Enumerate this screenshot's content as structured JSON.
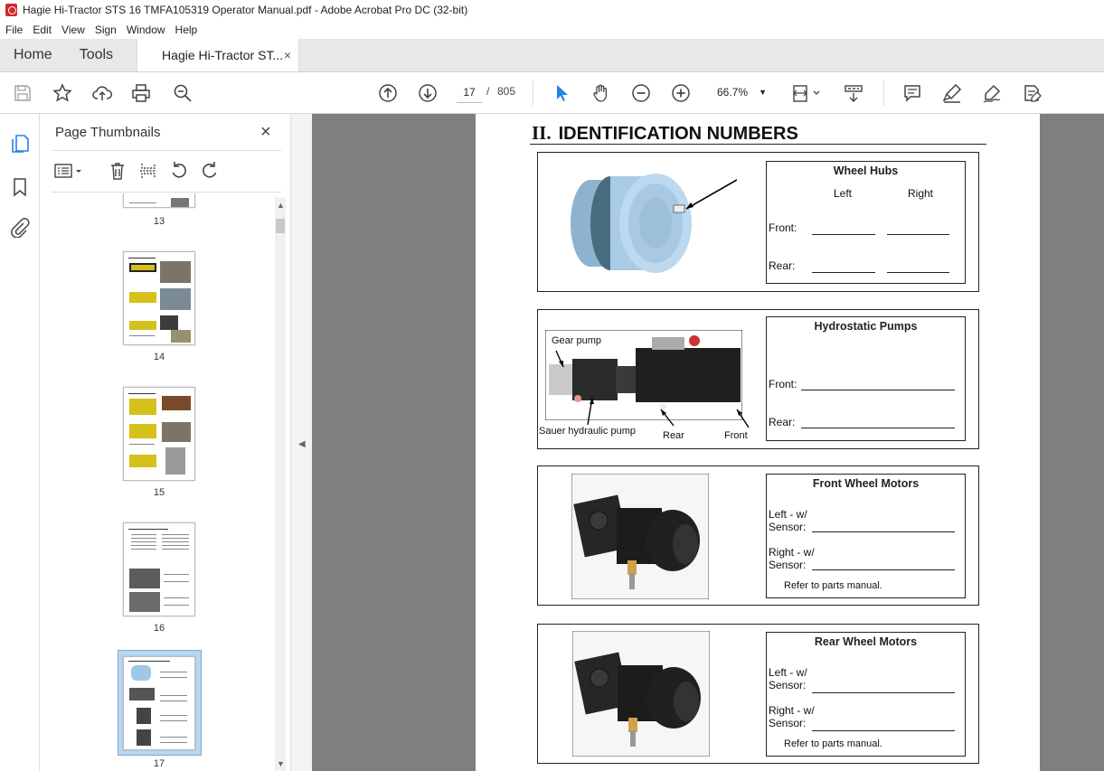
{
  "window": {
    "title": "Hagie Hi-Tractor STS 16 TMFA105319 Operator Manual.pdf - Adobe Acrobat Pro DC (32-bit)"
  },
  "menu": [
    "File",
    "Edit",
    "View",
    "Sign",
    "Window",
    "Help"
  ],
  "tabs": {
    "home": "Home",
    "tools": "Tools",
    "doc": "Hagie Hi-Tractor ST...",
    "close": "×"
  },
  "toolbar": {
    "page_current": "17",
    "page_sep": "/",
    "page_total": "805",
    "zoom": "66.7%"
  },
  "thumbnails": {
    "title": "Page Thumbnails",
    "close": "×",
    "pages": [
      "13",
      "14",
      "15",
      "16",
      "17"
    ],
    "selected": "17"
  },
  "document": {
    "roman": "II.",
    "heading": "IDENTIFICATION NUMBERS",
    "wheel_hubs": {
      "title": "Wheel Hubs",
      "left": "Left",
      "right": "Right",
      "front": "Front:",
      "rear": "Rear:"
    },
    "hydrostatic": {
      "title": "Hydrostatic Pumps",
      "front": "Front:",
      "rear": "Rear:",
      "callouts": {
        "gear": "Gear pump",
        "sauer": "Sauer hydraulic pump",
        "rear": "Rear",
        "front": "Front"
      }
    },
    "front_motors": {
      "title": "Front Wheel Motors",
      "left1": "Left - w/",
      "left2": "Sensor:",
      "right1": "Right - w/",
      "right2": "Sensor:",
      "note": "Refer to parts manual."
    },
    "rear_motors": {
      "title": "Rear Wheel Motors",
      "left1": "Left - w/",
      "left2": "Sensor:",
      "right1": "Right - w/",
      "right2": "Sensor:",
      "note": "Refer to parts manual."
    }
  },
  "colors": {
    "accent": "#2680eb",
    "pdf_red": "#d4282d",
    "selected_thumb": "#bcd6ef"
  }
}
